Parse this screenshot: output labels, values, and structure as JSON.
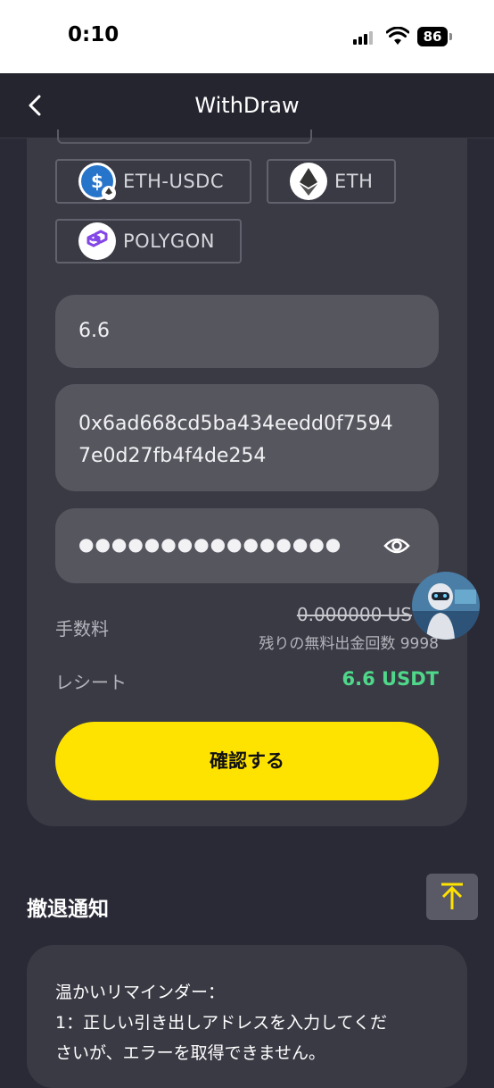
{
  "status_bar": {
    "time": "0:10",
    "battery": "86"
  },
  "nav": {
    "title": "WithDraw"
  },
  "networks": [
    {
      "label": "ETH-USDC",
      "icon": "usdc-eth-icon"
    },
    {
      "label": "ETH",
      "icon": "eth-icon"
    },
    {
      "label": "POLYGON",
      "icon": "polygon-icon"
    }
  ],
  "form": {
    "amount": "6.6",
    "address_line1": "0x6ad668cd5ba434eedd0f7594",
    "address_line2": "7e0d27fb4f4de254",
    "password_mask": "●●●●●●●●●●●●●●●●"
  },
  "fee": {
    "label": "手数料",
    "value": "0.000000 US",
    "free_count": "残りの無料出金回数 9998"
  },
  "receipt": {
    "label": "レシート",
    "value": "6.6 USDT"
  },
  "confirm_label": "確認する",
  "notice": {
    "title": "撤退通知",
    "line1": "温かいリマインダー：",
    "line2": "1：正しい引き出しアドレスを入力してくだ",
    "line3": "さいが、エラーを取得できません。"
  },
  "colors": {
    "accent_yellow": "#ffe300",
    "receipt_green": "#4fd889",
    "background": "#2a2a36",
    "card": "#3a3a45"
  }
}
